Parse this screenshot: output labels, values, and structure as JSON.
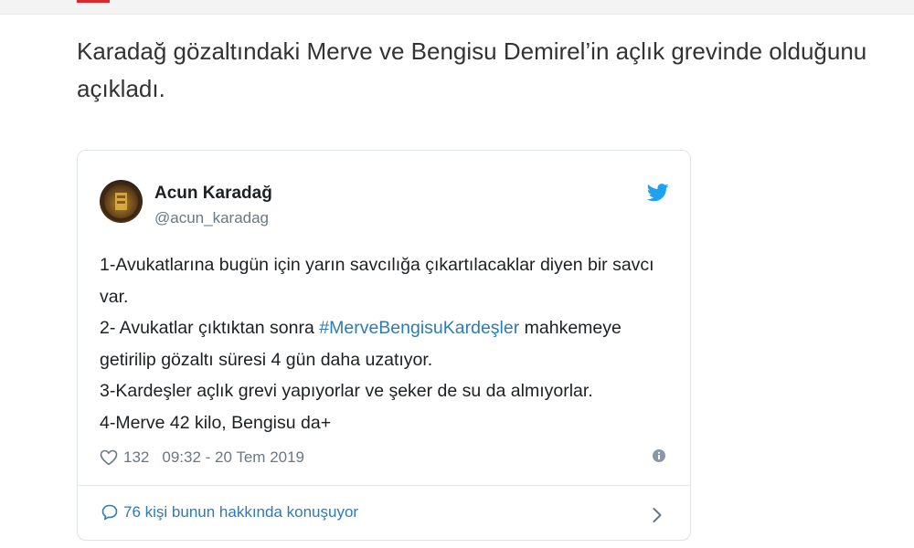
{
  "headline": "Karadağ gözaltındaki Merve ve Bengisu Demirel’in açlık grevinde olduğunu açıkladı.",
  "tweet": {
    "author_name": "Acun Karadağ",
    "author_handle": "@acun_karadag",
    "lines": {
      "l1": "1-Avukatlarına bugün için yarın savcılığa çıkartılacaklar diyen bir savcı var.",
      "l2_pre": "2- Avukatlar çıktıktan sonra ",
      "l2_hashtag": "#MerveBengisuKardeşler",
      "l2_post": " mahkemeye getirilip gözaltı süresi 4 gün daha uzatıyor.",
      "l3": "3-Kardeşler açlık grevi yapıyorlar ve şeker de su da almıyorlar.",
      "l4": "4-Merve 42 kilo, Bengisu da+"
    },
    "likes": "132",
    "timestamp": "09:32 - 20 Tem 2019",
    "conversation_text": "76 kişi bunun hakkında konuşuyor"
  },
  "icons": {
    "twitter": "twitter-bird-icon",
    "heart": "heart-icon",
    "info": "info-icon",
    "bubble": "speech-bubble-icon",
    "chevron": "chevron-right-icon"
  },
  "colors": {
    "accent_red": "#d8272d",
    "twitter_blue": "#1da1f2",
    "link_blue": "#2b7bb9",
    "text_dark": "#1c2022",
    "text_muted": "#697882"
  }
}
